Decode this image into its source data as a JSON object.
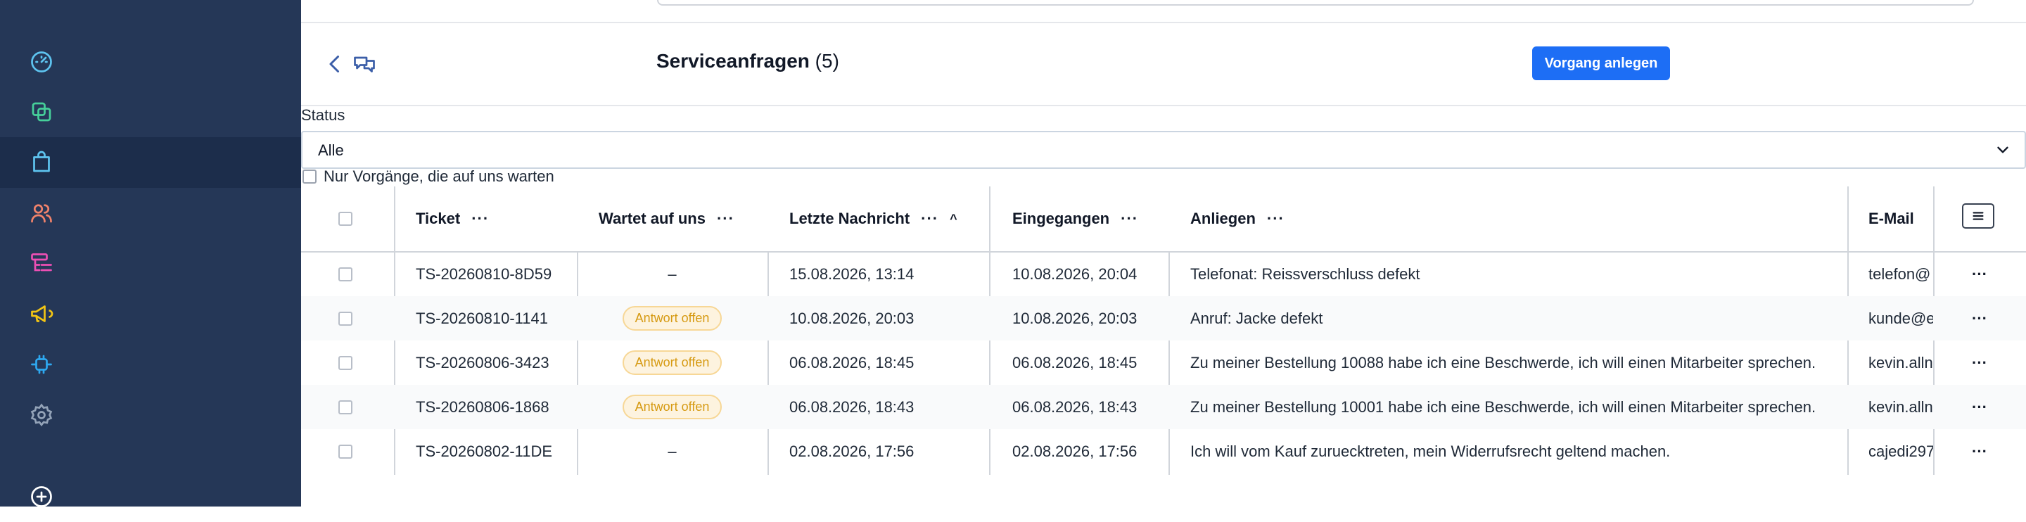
{
  "sidebar": {
    "items": [
      {
        "icon": "dashboard-gauge-icon",
        "color": "#5ec4f0",
        "active": false
      },
      {
        "icon": "copy-squares-icon",
        "color": "#46d09a",
        "active": false
      },
      {
        "icon": "shopping-bag-icon",
        "color": "#5ec4f0",
        "active": true
      },
      {
        "icon": "users-icon",
        "color": "#f2836b",
        "active": false
      },
      {
        "icon": "list-tree-icon",
        "color": "#ec4fb4",
        "active": false
      },
      {
        "icon": "megaphone-icon",
        "color": "#f3c514",
        "active": false
      },
      {
        "icon": "plugin-icon",
        "color": "#2ea8f0",
        "active": false
      },
      {
        "icon": "gear-icon",
        "color": "#94a3b8",
        "active": false
      },
      {
        "icon": "plus-circle-icon",
        "color": "#ffffff",
        "active": false
      }
    ]
  },
  "header": {
    "title": "Serviceanfragen",
    "count": "(5)",
    "create_button": "Vorgang anlegen"
  },
  "filter": {
    "status_label": "Status",
    "status_value": "Alle",
    "waiting_checkbox_label": "Nur Vorgänge, die auf uns warten"
  },
  "table": {
    "columns": {
      "ticket": "Ticket",
      "waiting": "Wartet auf uns",
      "last_message": "Letzte Nachricht",
      "received": "Eingegangen",
      "concern": "Anliegen",
      "email": "E-Mail"
    },
    "more": "···",
    "sort_indicator": "^",
    "rows": [
      {
        "ticket": "TS-20260810-8D59",
        "waiting": "–",
        "waiting_badge": false,
        "last_message": "15.08.2026, 13:14",
        "received": "10.08.2026, 20:04",
        "concern": "Telefonat: Reissverschluss defekt",
        "email": "telefon@"
      },
      {
        "ticket": "TS-20260810-1141",
        "waiting": "Antwort offen",
        "waiting_badge": true,
        "last_message": "10.08.2026, 20:03",
        "received": "10.08.2026, 20:03",
        "concern": "Anruf: Jacke defekt",
        "email": "kunde@e"
      },
      {
        "ticket": "TS-20260806-3423",
        "waiting": "Antwort offen",
        "waiting_badge": true,
        "last_message": "06.08.2026, 18:45",
        "received": "06.08.2026, 18:45",
        "concern": "Zu meiner Bestellung 10088 habe ich eine Beschwerde, ich will einen Mitarbeiter sprechen.",
        "email": "kevin.alln"
      },
      {
        "ticket": "TS-20260806-1868",
        "waiting": "Antwort offen",
        "waiting_badge": true,
        "last_message": "06.08.2026, 18:43",
        "received": "06.08.2026, 18:43",
        "concern": "Zu meiner Bestellung 10001 habe ich eine Beschwerde, ich will einen Mitarbeiter sprechen.",
        "email": "kevin.alln"
      },
      {
        "ticket": "TS-20260802-11DE",
        "waiting": "–",
        "waiting_badge": false,
        "last_message": "02.08.2026, 17:56",
        "received": "02.08.2026, 17:56",
        "concern": "Ich will vom Kauf zuruecktreten, mein Widerrufsrecht geltend machen.",
        "email": "cajedi297"
      }
    ]
  },
  "colors": {
    "sidebar_bg": "#253757",
    "sidebar_active": "#1c2d4b",
    "primary": "#1d6ef5",
    "badge_text": "#d69a12",
    "badge_bg": "#fdf3df"
  }
}
